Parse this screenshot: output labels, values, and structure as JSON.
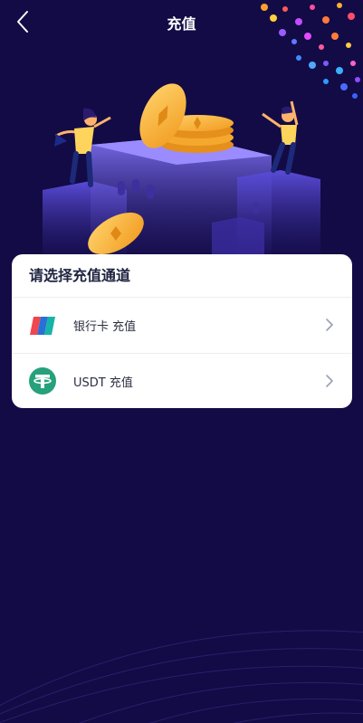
{
  "header": {
    "title": "充值",
    "back_icon": "chevron-left-icon"
  },
  "card": {
    "title": "请选择充值通道",
    "options": [
      {
        "label": "银行卡 充值",
        "icon": "bank-card-icon"
      },
      {
        "label": "USDT 充值",
        "icon": "tether-icon"
      }
    ]
  },
  "colors": {
    "background": "#130b45",
    "card": "#ffffff",
    "tether": "#26a17b",
    "coin": "#f7b33b"
  }
}
